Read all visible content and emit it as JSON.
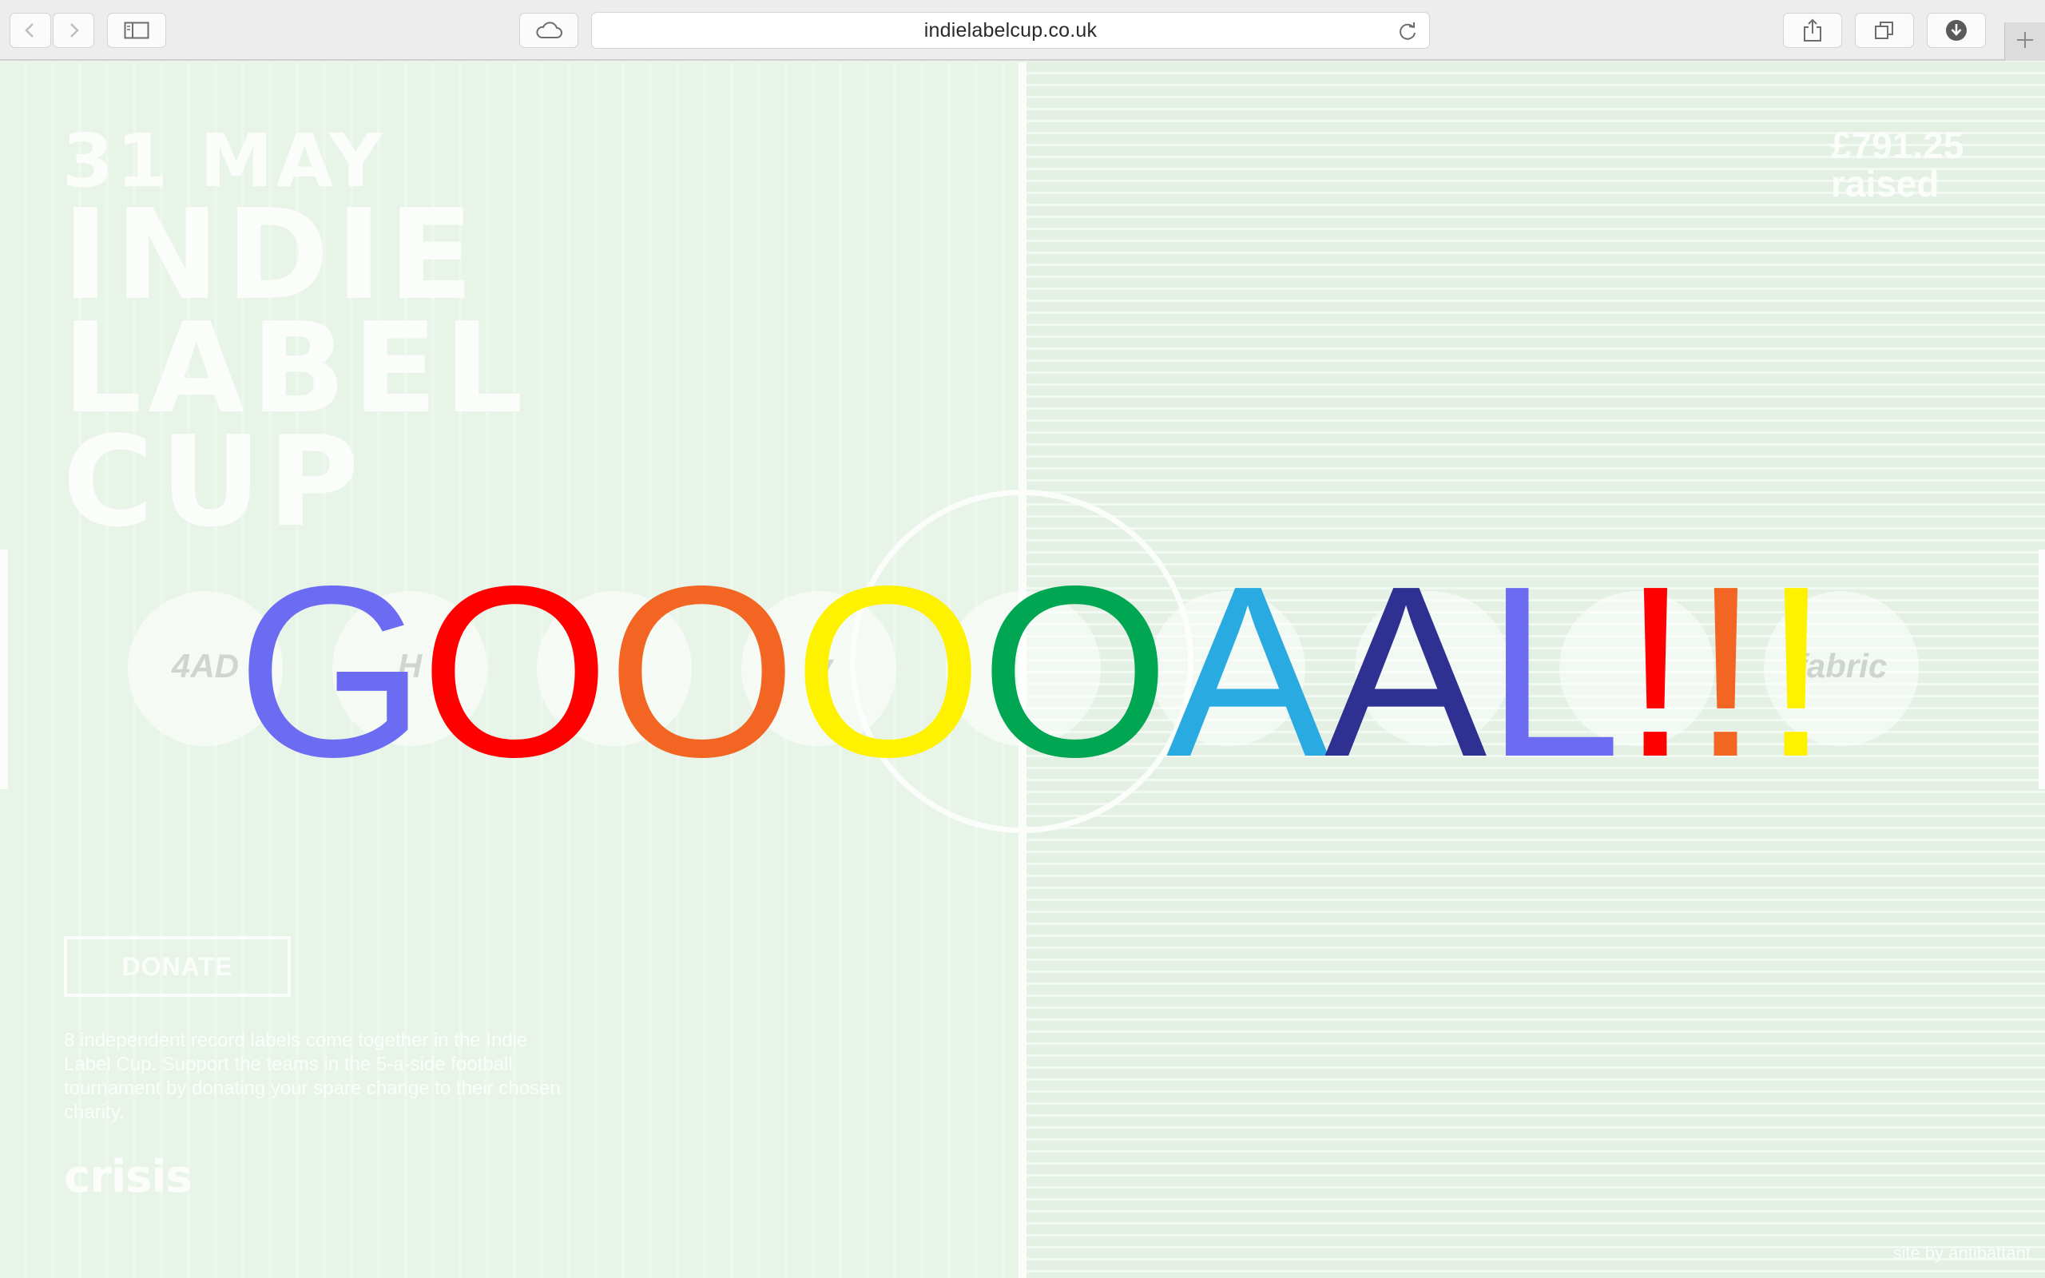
{
  "browser": {
    "url": "indielabelcup.co.uk",
    "icons": {
      "back": "chevron-left-icon",
      "forward": "chevron-right-icon",
      "sidebar": "sidebar-icon",
      "icloud": "cloud-icon",
      "reload": "reload-icon",
      "share": "share-icon",
      "tabs": "tabs-icon",
      "downloads": "download-icon",
      "new_tab": "plus-icon"
    }
  },
  "page": {
    "logo": {
      "date": "31 MAY",
      "line1": "INDIE",
      "line2": "LABEL",
      "line3": "CUP"
    },
    "raised": {
      "amount": "£791.25",
      "label": "raised"
    },
    "donate_label": "DONATE",
    "description": "8 independent record labels come together in the Indie Label Cup. Support the teams in the 5-a-side football tournament by donating your spare change to their chosen charity.",
    "charity_logo": "crisis",
    "credit": "site by antibattant",
    "team_crests": [
      "4AD",
      "H",
      "",
      "ly",
      "",
      "",
      "",
      "",
      "fabric"
    ]
  },
  "goal": {
    "letters": [
      {
        "char": "G",
        "color": "#6b6cf2"
      },
      {
        "char": "O",
        "color": "#ff0000"
      },
      {
        "char": "O",
        "color": "#f26522"
      },
      {
        "char": "O",
        "color": "#fff200"
      },
      {
        "char": "O",
        "color": "#00a651"
      },
      {
        "char": "A",
        "color": "#29abe2"
      },
      {
        "char": "A",
        "color": "#2e3192"
      },
      {
        "char": "L",
        "color": "#6b6cf2"
      },
      {
        "char": "!",
        "color": "#ff0000"
      },
      {
        "char": "!",
        "color": "#f26522"
      },
      {
        "char": "!",
        "color": "#fff200"
      }
    ]
  }
}
